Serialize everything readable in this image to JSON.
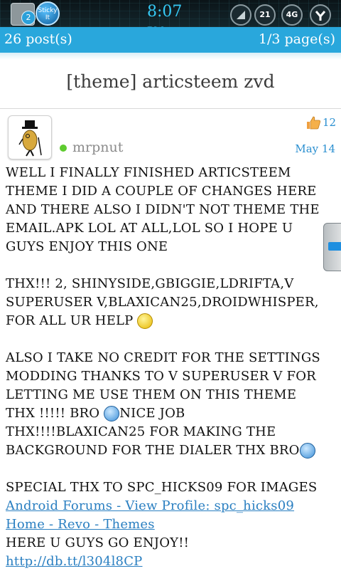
{
  "status_bar": {
    "notification_count": "2",
    "sticky_label": "Sticky It",
    "time": "8:07",
    "time_suffix": "PM",
    "signal_icon": "signal-bars-icon",
    "battery_label": "21",
    "network_label": "4G",
    "wifi_icon": "wifi-y-icon"
  },
  "page_bar": {
    "posts": "26 post(s)",
    "pages": "1/3 page(s)"
  },
  "topic": {
    "title": "[theme] articsteem zvd"
  },
  "post": {
    "username": "mrpnut",
    "likes": "12",
    "date": "May 14",
    "para1": "WELL I FINALLY FINISHED ARTICSTEEM THEME I DID A COUPLE OF CHANGES HERE AND THERE ALSO I DIDN'T NOT THEME THE EMAIL.APK LOL AT ALL,LOL SO I HOPE U GUYS ENJOY THIS ONE",
    "para2": "THX!!! 2, SHINYSIDE,GBIGGIE,LDRIFTA,V SUPERUSER V,BLAXICAN25,DROIDWHISPER, FOR ALL UR HELP",
    "para3a": "ALSO I TAKE NO CREDIT FOR THE SETTINGS MODDING THANKS TO V SUPERUSER V FOR LETTING ME USE THEM ON THIS THEME THX !!!!! BRO",
    "para3b": "NICE JOB",
    "para3c": "THX!!!!BLAXICAN25 FOR MAKING THE BACKGROUND FOR THE DIALER THX BRO",
    "para4": "SPECIAL THX TO SPC_HICKS09 FOR IMAGES",
    "link1": "Android Forums - View Profile: spc_hicks09",
    "link2": "Home - Revo - Themes",
    "para5": "HERE U GUYS GO ENJOY!!",
    "link3": "http://db.tt/l304l8CP"
  }
}
